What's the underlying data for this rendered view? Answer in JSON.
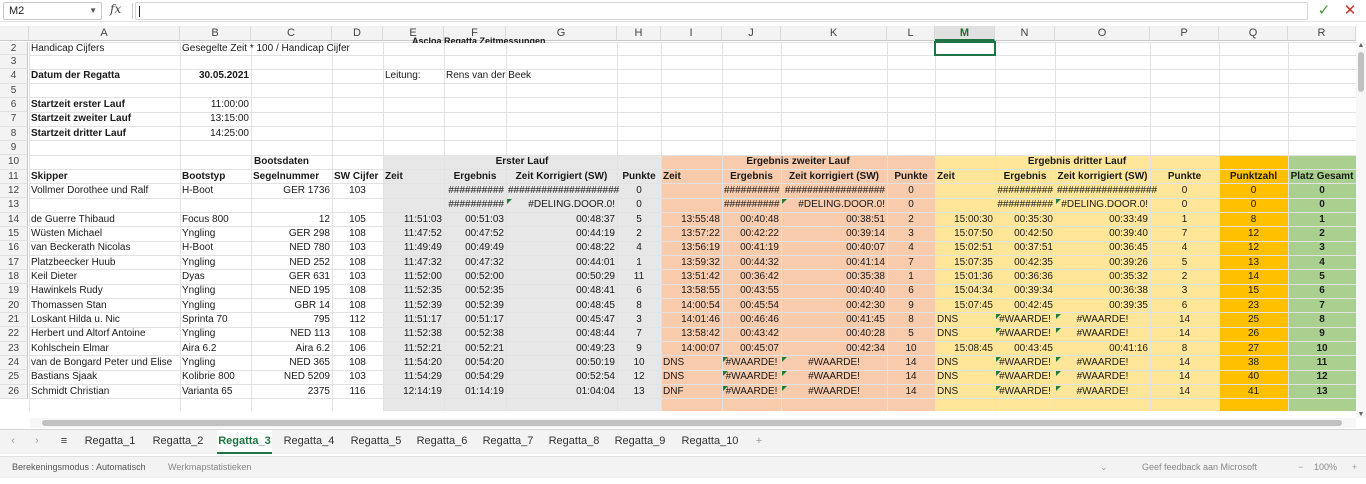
{
  "formula_bar": {
    "name_box": "M2",
    "fx": "fx",
    "formula": ""
  },
  "columns": [
    "A",
    "B",
    "C",
    "D",
    "E",
    "F",
    "G",
    "H",
    "I",
    "J",
    "K",
    "L",
    "M",
    "N",
    "O",
    "P",
    "Q",
    "R"
  ],
  "selected_column": "M",
  "rows": [
    "2",
    "3",
    "4",
    "5",
    "6",
    "7",
    "8",
    "9",
    "10",
    "11",
    "12",
    "13",
    "14",
    "15",
    "16",
    "17",
    "18",
    "19",
    "20",
    "21",
    "22",
    "23",
    "24",
    "25",
    "26"
  ],
  "title_partial": "Ascloa Regatta Zeitmessungen",
  "header": {
    "handicap_label": "Handicap Cijfers",
    "formula_label": "Gesegelte Zeit * 100 / Handicap Cijfer",
    "datum_label": "Datum der Regatta",
    "datum_value": "30.05.2021",
    "leitung_label": "Leitung:",
    "leitung_value": "Rens van der Beek",
    "start1_label": "Startzeit erster Lauf",
    "start1": "11:00:00",
    "start2_label": "Startzeit zweiter Lauf",
    "start2": "13:15:00",
    "start3_label": "Startzeit dritter Lauf",
    "start3": "14:25:00"
  },
  "groups": {
    "boot": "Bootsdaten",
    "lauf1": "Erster Lauf",
    "lauf2": "Ergebnis zweiter Lauf",
    "lauf3": "Ergebnis dritter Lauf"
  },
  "col_headers": [
    "Skipper",
    "Bootstyp",
    "Segelnummer",
    "SW Cijfer",
    "Zeit",
    "Ergebnis",
    "Zeit  Korrigiert (SW)",
    "Punkte",
    "Zeit",
    "Ergebnis",
    "Zeit korrigiert (SW)",
    "Punkte",
    "Zeit",
    "Ergebnis",
    "Zeit korrigiert (SW)",
    "Punkte",
    "Punktzahl",
    "Platz Gesamt"
  ],
  "table": [
    [
      "Vollmer Dorothee und Ralf",
      "H-Boot",
      "GER 1736",
      "103",
      "",
      "##########",
      "####################",
      "0",
      "",
      "##########",
      "##################",
      "0",
      "",
      "##########",
      "##################",
      "0",
      "0",
      "0"
    ],
    [
      "",
      "",
      "",
      "",
      "",
      "##########",
      "#DELING.DOOR.0!",
      "0",
      "",
      "##########",
      "#DELING.DOOR.0!",
      "0",
      "",
      "##########",
      "#DELING.DOOR.0!",
      "0",
      "0",
      "0"
    ],
    [
      "de Guerre Thibaud",
      "Focus 800",
      "12",
      "105",
      "11:51:03",
      "00:51:03",
      "00:48:37",
      "5",
      "13:55:48",
      "00:40:48",
      "00:38:51",
      "2",
      "15:00:30",
      "00:35:30",
      "00:33:49",
      "1",
      "8",
      "1"
    ],
    [
      "Wüsten Michael",
      "Yngling",
      "GER 298",
      "108",
      "11:47:52",
      "00:47:52",
      "00:44:19",
      "2",
      "13:57:22",
      "00:42:22",
      "00:39:14",
      "3",
      "15:07:50",
      "00:42:50",
      "00:39:40",
      "7",
      "12",
      "2"
    ],
    [
      " van Beckerath Nicolas",
      "H-Boot",
      "NED 780",
      "103",
      "11:49:49",
      "00:49:49",
      "00:48:22",
      "4",
      "13:56:19",
      "00:41:19",
      "00:40:07",
      "4",
      "15:02:51",
      "00:37:51",
      "00:36:45",
      "4",
      "12",
      "3"
    ],
    [
      "Platzbeecker Huub",
      "Yngling",
      "NED 252",
      "108",
      "11:47:32",
      "00:47:32",
      "00:44:01",
      "1",
      "13:59:32",
      "00:44:32",
      "00:41:14",
      "7",
      "15:07:35",
      "00:42:35",
      "00:39:26",
      "5",
      "13",
      "4"
    ],
    [
      "Keil Dieter",
      "Dyas",
      "GER 631",
      "103",
      "11:52:00",
      "00:52:00",
      "00:50:29",
      "11",
      "13:51:42",
      "00:36:42",
      "00:35:38",
      "1",
      "15:01:36",
      "00:36:36",
      "00:35:32",
      "2",
      "14",
      "5"
    ],
    [
      "Hawinkels Rudy",
      "Yngling",
      "NED 195",
      "108",
      "11:52:35",
      "00:52:35",
      "00:48:41",
      "6",
      "13:58:55",
      "00:43:55",
      "00:40:40",
      "6",
      "15:04:34",
      "00:39:34",
      "00:36:38",
      "3",
      "15",
      "6"
    ],
    [
      "Thomassen Stan",
      "Yngling",
      "GBR 14",
      "108",
      "11:52:39",
      "00:52:39",
      "00:48:45",
      "8",
      "14:00:54",
      "00:45:54",
      "00:42:30",
      "9",
      "15:07:45",
      "00:42:45",
      "00:39:35",
      "6",
      "23",
      "7"
    ],
    [
      "Loskant Hilda u. Nic",
      "Sprinta 70",
      "795",
      "112",
      "11:51:17",
      "00:51:17",
      "00:45:47",
      "3",
      "14:01:46",
      "00:46:46",
      "00:41:45",
      "8",
      "DNS",
      "#WAARDE!",
      "#WAARDE!",
      "14",
      "25",
      "8"
    ],
    [
      "Herbert und Altorf Antoine",
      "Yngling",
      "NED 113",
      "108",
      "11:52:38",
      "00:52:38",
      "00:48:44",
      "7",
      "13:58:42",
      "00:43:42",
      "00:40:28",
      "5",
      "DNS",
      "#WAARDE!",
      "#WAARDE!",
      "14",
      "26",
      "9"
    ],
    [
      "Kohlschein Elmar",
      "Aira 6.2",
      "Aira 6.2",
      "106",
      "11:52:21",
      "00:52:21",
      "00:49:23",
      "9",
      "14:00:07",
      "00:45:07",
      "00:42:34",
      "10",
      "15:08:45",
      "00:43:45",
      "00:41:16",
      "8",
      "27",
      "10"
    ],
    [
      "van de Bongard Peter und Elise",
      "Yngling",
      "NED 365",
      "108",
      "11:54:20",
      "00:54:20",
      "00:50:19",
      "10",
      "DNS",
      "#WAARDE!",
      "#WAARDE!",
      "14",
      "DNS",
      "#WAARDE!",
      "#WAARDE!",
      "14",
      "38",
      "11"
    ],
    [
      "Bastians Sjaak",
      "Kolibrie 800",
      "NED 5209",
      "103",
      "11:54:29",
      "00:54:29",
      "00:52:54",
      "12",
      "DNS",
      "#WAARDE!",
      "#WAARDE!",
      "14",
      "DNS",
      "#WAARDE!",
      "#WAARDE!",
      "14",
      "40",
      "12"
    ],
    [
      "Schmidt Christian",
      "Varianta 65",
      "2375",
      "116",
      "12:14:19",
      "01:14:19",
      "01:04:04",
      "13",
      "DNF",
      "#WAARDE!",
      "#WAARDE!",
      "14",
      "DNS",
      "#WAARDE!",
      "#WAARDE!",
      "14",
      "41",
      "13"
    ]
  ],
  "colors": {
    "lauf1": "#e7e7e7",
    "lauf2": "#f8cbad",
    "lauf3": "#ffe699",
    "punktzahl": "#ffc000",
    "platz": "#a9d08e",
    "accent": "#217346"
  },
  "sheet_tabs": [
    "Regatta_1",
    "Regatta_2",
    "Regatta_3",
    "Regatta_4",
    "Regatta_5",
    "Regatta_6",
    "Regatta_7",
    "Regatta_8",
    "Regatta_9",
    "Regatta_10"
  ],
  "active_tab": "Regatta_3",
  "status": {
    "mode": "Berekeningsmodus : Automatisch",
    "stats": "Werkmapstatistieken",
    "feedback": "Geef feedback aan Microsoft",
    "zoom": "100%"
  }
}
